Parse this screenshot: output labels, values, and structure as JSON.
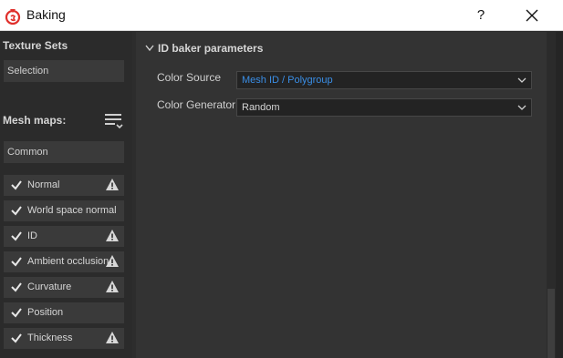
{
  "window": {
    "title": "Baking",
    "help_label": "?",
    "close_label": "✕"
  },
  "sidebar": {
    "texture_sets_label": "Texture Sets",
    "selection_field": "Selection",
    "mesh_maps_label": "Mesh maps:",
    "common_field": "Common",
    "maps": [
      {
        "label": "Normal",
        "checked": true,
        "warning": true
      },
      {
        "label": "World space normal",
        "checked": true,
        "warning": false
      },
      {
        "label": "ID",
        "checked": true,
        "warning": true
      },
      {
        "label": "Ambient occlusion",
        "checked": true,
        "warning": true
      },
      {
        "label": "Curvature",
        "checked": true,
        "warning": true
      },
      {
        "label": "Position",
        "checked": true,
        "warning": false
      },
      {
        "label": "Thickness",
        "checked": true,
        "warning": true
      }
    ]
  },
  "main": {
    "section_title": "ID baker parameters",
    "color_source": {
      "label": "Color Source",
      "value": "Mesh ID / Polygroup",
      "value_color": "#3a8ee6"
    },
    "color_generator": {
      "label": "Color Generator",
      "value": "Random"
    }
  },
  "colors": {
    "accent": "#3a8ee6",
    "brand_red": "#e0302c",
    "warning": "#d8d8d8"
  }
}
